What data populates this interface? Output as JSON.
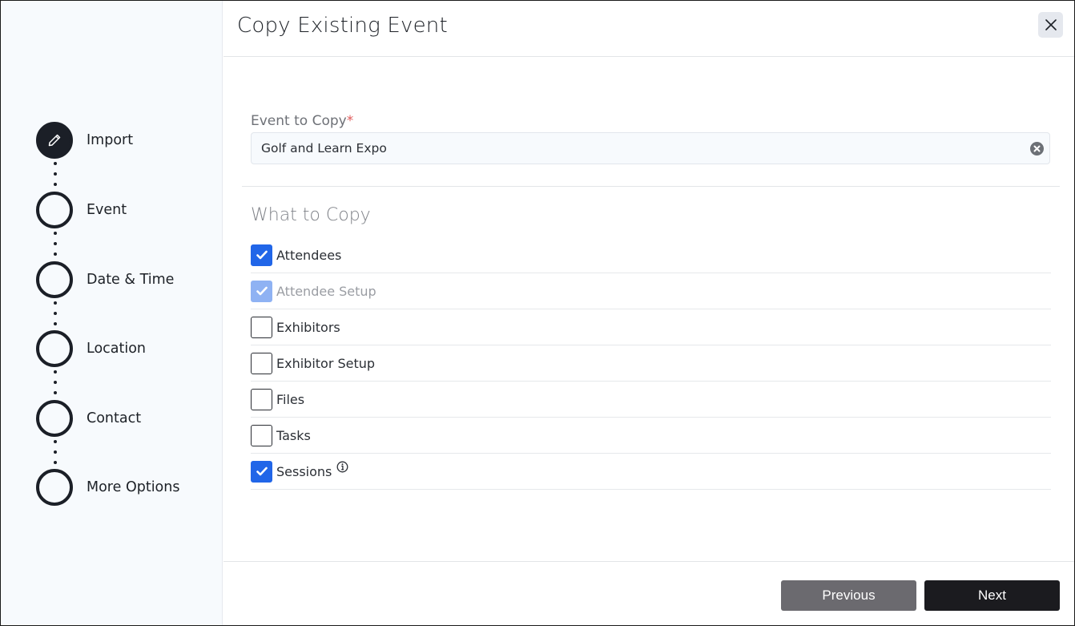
{
  "dialog": {
    "title": "Copy Existing Event",
    "close_icon": "close-icon"
  },
  "steps": [
    {
      "label": "Import",
      "state": "active",
      "icon": "pencil-icon"
    },
    {
      "label": "Event",
      "state": "pending"
    },
    {
      "label": "Date & Time",
      "state": "pending"
    },
    {
      "label": "Location",
      "state": "pending"
    },
    {
      "label": "Contact",
      "state": "pending"
    },
    {
      "label": "More Options",
      "state": "pending"
    }
  ],
  "form": {
    "event_label": "Event to Copy",
    "required_mark": "*",
    "event_value": "Golf and Learn Expo",
    "section_title": "What to Copy",
    "options": [
      {
        "label": "Attendees",
        "checked": true,
        "disabled": false
      },
      {
        "label": "Attendee Setup",
        "checked": true,
        "disabled": true
      },
      {
        "label": "Exhibitors",
        "checked": false,
        "disabled": false
      },
      {
        "label": "Exhibitor Setup",
        "checked": false,
        "disabled": false
      },
      {
        "label": "Files",
        "checked": false,
        "disabled": false
      },
      {
        "label": "Tasks",
        "checked": false,
        "disabled": false
      },
      {
        "label": "Sessions",
        "checked": true,
        "disabled": false,
        "info": true
      }
    ]
  },
  "footer": {
    "previous_label": "Previous",
    "next_label": "Next"
  },
  "colors": {
    "accent": "#2166e8",
    "accent_disabled": "#8fb2f3",
    "dark": "#1b1f27",
    "secondary_button": "#6b6a6f",
    "required": "#e05a5a"
  }
}
